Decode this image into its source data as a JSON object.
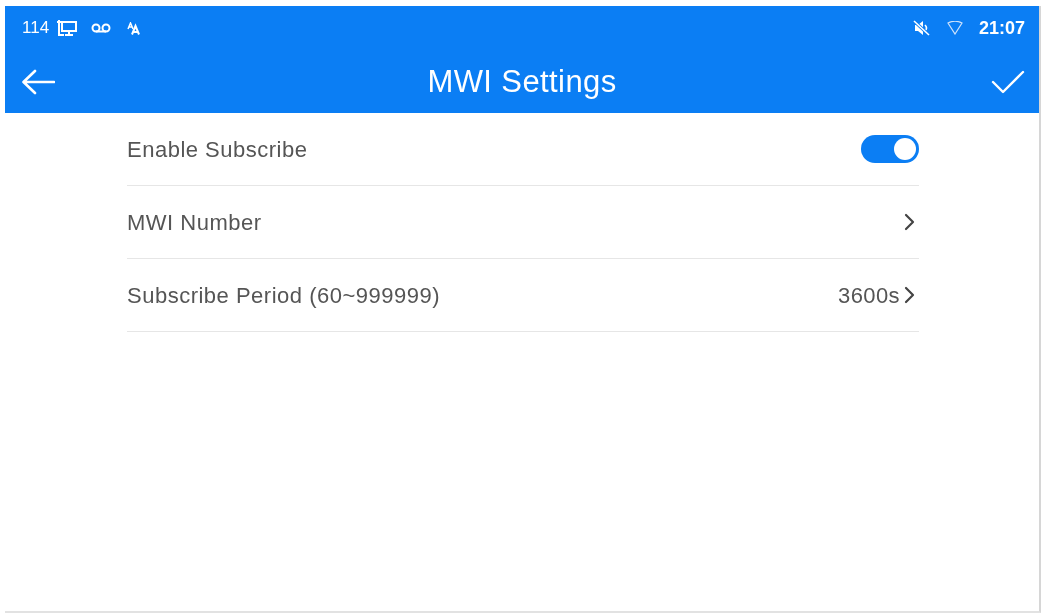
{
  "status_bar": {
    "extension": "114",
    "time": "21:07"
  },
  "header": {
    "title": "MWI Settings"
  },
  "settings": [
    {
      "kind": "toggle",
      "label": "Enable Subscribe",
      "on": true
    },
    {
      "kind": "link",
      "label": "MWI Number"
    },
    {
      "kind": "link",
      "label": "Subscribe Period (60~999999)",
      "value": "3600s"
    }
  ]
}
